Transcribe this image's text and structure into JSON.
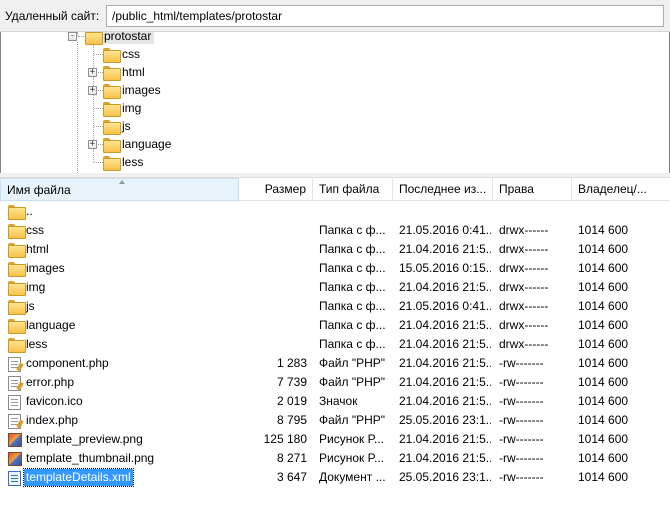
{
  "pathbar": {
    "label": "Удаленный сайт:",
    "path": "/public_html/templates/protostar"
  },
  "tree": {
    "parent": {
      "name": "protostar",
      "expander": "-"
    },
    "children": [
      {
        "name": "css",
        "expander": ""
      },
      {
        "name": "html",
        "expander": "+"
      },
      {
        "name": "images",
        "expander": "+"
      },
      {
        "name": "img",
        "expander": ""
      },
      {
        "name": "js",
        "expander": ""
      },
      {
        "name": "language",
        "expander": "+"
      },
      {
        "name": "less",
        "expander": ""
      }
    ]
  },
  "columns": {
    "name": "Имя файла",
    "size": "Размер",
    "type": "Тип файла",
    "modified": "Последнее из...",
    "perms": "Права",
    "owner": "Владелец/..."
  },
  "files": [
    {
      "name": "..",
      "size": "",
      "type": "",
      "modified": "",
      "perms": "",
      "owner": "",
      "icon": "folder-icon"
    },
    {
      "name": "css",
      "size": "",
      "type": "Папка с ф...",
      "modified": "21.05.2016 0:41...",
      "perms": "drwx------",
      "owner": "1014 600",
      "icon": "folder-icon"
    },
    {
      "name": "html",
      "size": "",
      "type": "Папка с ф...",
      "modified": "21.04.2016 21:5...",
      "perms": "drwx------",
      "owner": "1014 600",
      "icon": "folder-icon"
    },
    {
      "name": "images",
      "size": "",
      "type": "Папка с ф...",
      "modified": "15.05.2016 0:15...",
      "perms": "drwx------",
      "owner": "1014 600",
      "icon": "folder-icon"
    },
    {
      "name": "img",
      "size": "",
      "type": "Папка с ф...",
      "modified": "21.04.2016 21:5...",
      "perms": "drwx------",
      "owner": "1014 600",
      "icon": "folder-icon"
    },
    {
      "name": "js",
      "size": "",
      "type": "Папка с ф...",
      "modified": "21.05.2016 0:41...",
      "perms": "drwx------",
      "owner": "1014 600",
      "icon": "folder-icon"
    },
    {
      "name": "language",
      "size": "",
      "type": "Папка с ф...",
      "modified": "21.04.2016 21:5...",
      "perms": "drwx------",
      "owner": "1014 600",
      "icon": "folder-icon"
    },
    {
      "name": "less",
      "size": "",
      "type": "Папка с ф...",
      "modified": "21.04.2016 21:5...",
      "perms": "drwx------",
      "owner": "1014 600",
      "icon": "folder-icon"
    },
    {
      "name": "component.php",
      "size": "1 283",
      "type": "Файл \"PHP\"",
      "modified": "21.04.2016 21:5...",
      "perms": "-rw-------",
      "owner": "1014 600",
      "icon": "php-file-icon"
    },
    {
      "name": "error.php",
      "size": "7 739",
      "type": "Файл \"PHP\"",
      "modified": "21.04.2016 21:5...",
      "perms": "-rw-------",
      "owner": "1014 600",
      "icon": "php-file-icon"
    },
    {
      "name": "favicon.ico",
      "size": "2 019",
      "type": "Значок",
      "modified": "21.04.2016 21:5...",
      "perms": "-rw-------",
      "owner": "1014 600",
      "icon": "file-icon"
    },
    {
      "name": "index.php",
      "size": "8 795",
      "type": "Файл \"PHP\"",
      "modified": "25.05.2016 23:1...",
      "perms": "-rw-------",
      "owner": "1014 600",
      "icon": "php-file-icon"
    },
    {
      "name": "template_preview.png",
      "size": "125 180",
      "type": "Рисунок P...",
      "modified": "21.04.2016 21:5...",
      "perms": "-rw-------",
      "owner": "1014 600",
      "icon": "image-file-icon"
    },
    {
      "name": "template_thumbnail.png",
      "size": "8 271",
      "type": "Рисунок P...",
      "modified": "21.04.2016 21:5...",
      "perms": "-rw-------",
      "owner": "1014 600",
      "icon": "image-file-icon"
    },
    {
      "name": "templateDetails.xml",
      "size": "3 647",
      "type": "Документ ...",
      "modified": "25.05.2016 23:1...",
      "perms": "-rw-------",
      "owner": "1014 600",
      "icon": "xml-file-icon",
      "selected": true
    }
  ],
  "colors": {
    "selection": "#3399ff",
    "sorted_header": "#e8f2fb"
  }
}
